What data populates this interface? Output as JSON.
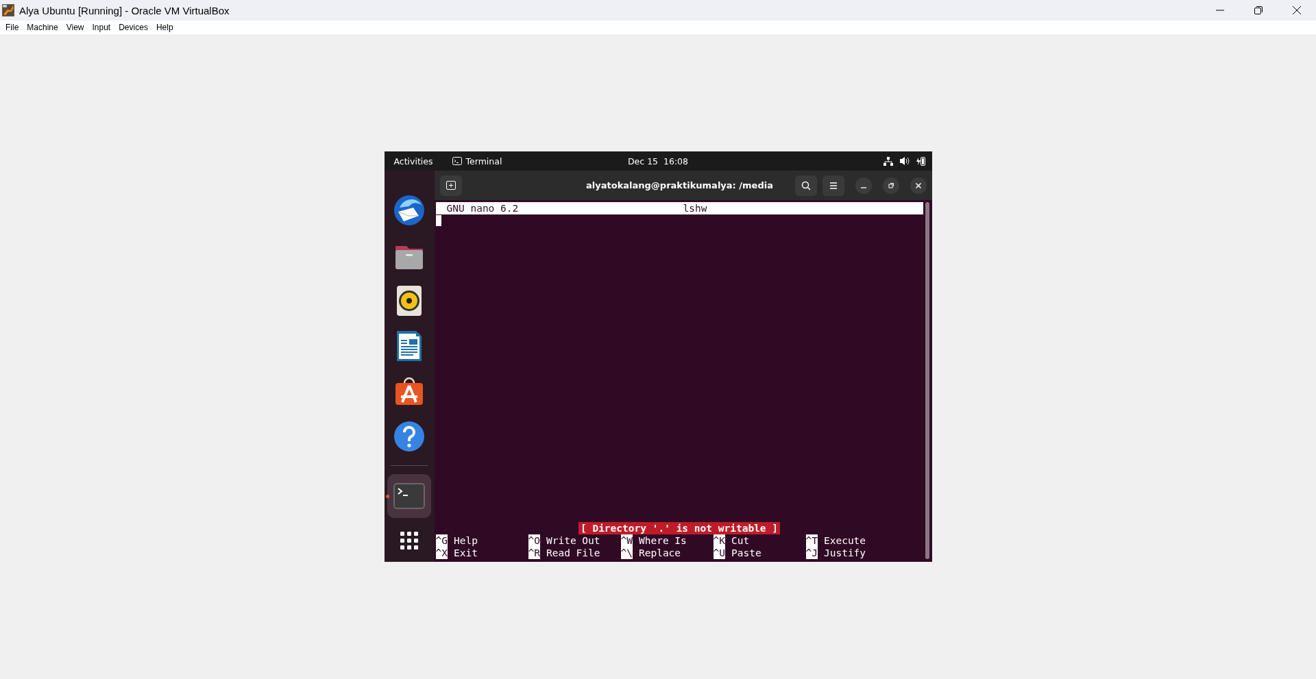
{
  "window": {
    "title": "Alya Ubuntu [Running] - Oracle VM VirtualBox"
  },
  "menu": [
    "File",
    "Machine",
    "View",
    "Input",
    "Devices",
    "Help"
  ],
  "topbar": {
    "activities": "Activities",
    "app": "Terminal",
    "clock": "Dec 15  16:08"
  },
  "dock": {
    "items": [
      {
        "kind": "mail",
        "active": false
      },
      {
        "kind": "files",
        "active": false
      },
      {
        "kind": "music",
        "active": false
      },
      {
        "kind": "writer",
        "active": false
      },
      {
        "kind": "store",
        "active": false
      },
      {
        "kind": "help",
        "active": false
      },
      {
        "kind": "terminal",
        "active": true
      }
    ]
  },
  "terminal": {
    "title": "alyatokalang@praktikumalya: /media",
    "nano": {
      "version": "GNU nano 6.2",
      "file": "lshw",
      "status": "[ Directory '.' is not writable ]",
      "shortcuts": [
        [
          {
            "key": "^G",
            "label": "Help"
          },
          {
            "key": "^O",
            "label": "Write Out"
          },
          {
            "key": "^W",
            "label": "Where Is"
          },
          {
            "key": "^K",
            "label": "Cut"
          },
          {
            "key": "^T",
            "label": "Execute"
          }
        ],
        [
          {
            "key": "^X",
            "label": "Exit"
          },
          {
            "key": "^R",
            "label": "Read File"
          },
          {
            "key": "^\\",
            "label": "Replace"
          },
          {
            "key": "^U",
            "label": "Paste"
          },
          {
            "key": "^J",
            "label": "Justify"
          }
        ]
      ]
    }
  }
}
